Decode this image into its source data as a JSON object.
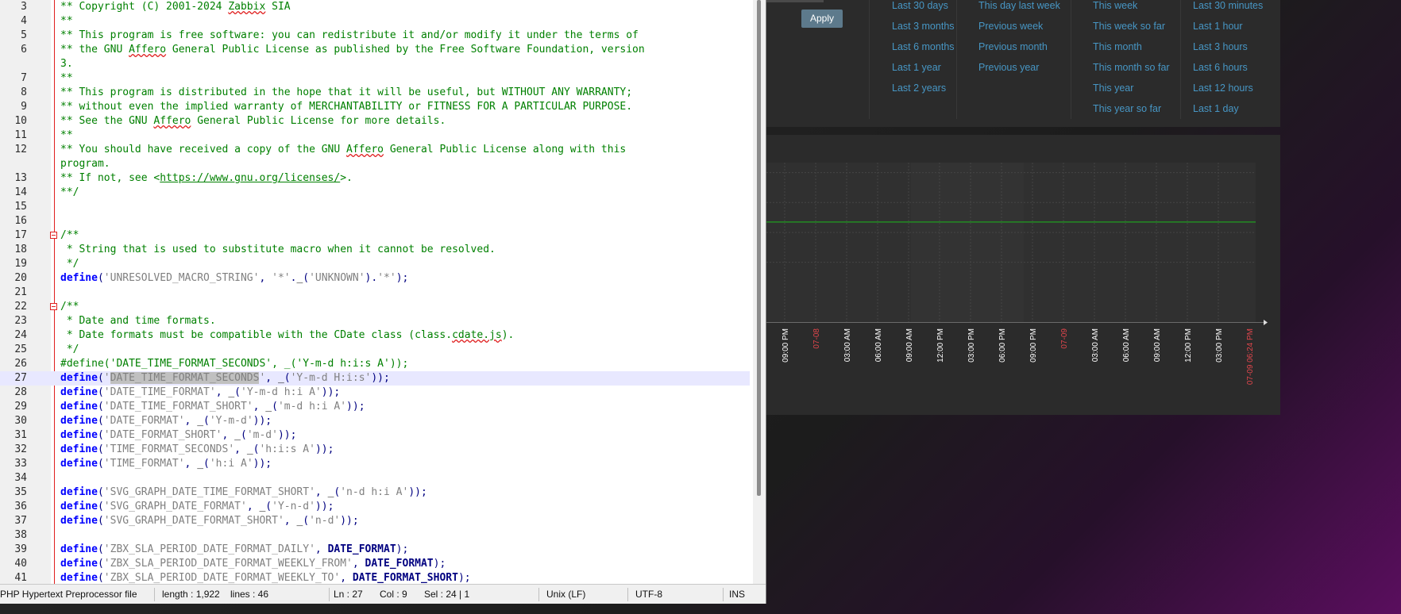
{
  "editor": {
    "lines": [
      {
        "n": "3",
        "fold": false,
        "t": [
          [
            "c",
            "** Copyright (C) 2001-2024 "
          ],
          [
            "cs",
            "Zabbix"
          ],
          [
            "c",
            " SIA"
          ]
        ]
      },
      {
        "n": "4",
        "fold": false,
        "t": [
          [
            "c",
            "**"
          ]
        ]
      },
      {
        "n": "5",
        "fold": false,
        "t": [
          [
            "c",
            "** This program is free software: you can redistribute it and/or modify it under the terms of"
          ]
        ]
      },
      {
        "n": "6",
        "fold": false,
        "t": [
          [
            "c",
            "** the GNU "
          ],
          [
            "cs",
            "Affero"
          ],
          [
            "c",
            " General Public License as published by the Free Software Foundation, version"
          ]
        ]
      },
      {
        "n": "",
        "fold": false,
        "t": [
          [
            "c",
            "3."
          ]
        ]
      },
      {
        "n": "7",
        "fold": false,
        "t": [
          [
            "c",
            "**"
          ]
        ]
      },
      {
        "n": "8",
        "fold": false,
        "t": [
          [
            "c",
            "** This program is distributed in the hope that it will be useful, but WITHOUT ANY WARRANTY;"
          ]
        ]
      },
      {
        "n": "9",
        "fold": false,
        "t": [
          [
            "c",
            "** without even the implied warranty of MERCHANTABILITY or FITNESS FOR A PARTICULAR PURPOSE."
          ]
        ]
      },
      {
        "n": "10",
        "fold": false,
        "t": [
          [
            "c",
            "** See the GNU "
          ],
          [
            "cs",
            "Affero"
          ],
          [
            "c",
            " General Public License for more details."
          ]
        ]
      },
      {
        "n": "11",
        "fold": false,
        "t": [
          [
            "c",
            "**"
          ]
        ]
      },
      {
        "n": "12",
        "fold": false,
        "t": [
          [
            "c",
            "** You should have received a copy of the GNU "
          ],
          [
            "cs",
            "Affero"
          ],
          [
            "c",
            " General Public License along with this"
          ]
        ]
      },
      {
        "n": "",
        "fold": false,
        "t": [
          [
            "c",
            "program."
          ]
        ]
      },
      {
        "n": "13",
        "fold": false,
        "t": [
          [
            "c",
            "** If not, see <"
          ],
          [
            "cu",
            "https://www.gnu.org/licenses/"
          ],
          [
            "c",
            ">."
          ]
        ]
      },
      {
        "n": "14",
        "fold": false,
        "t": [
          [
            "c",
            "**/"
          ]
        ]
      },
      {
        "n": "15",
        "fold": false,
        "t": []
      },
      {
        "n": "16",
        "fold": false,
        "t": []
      },
      {
        "n": "17",
        "fold": true,
        "t": [
          [
            "c",
            "/**"
          ]
        ]
      },
      {
        "n": "18",
        "fold": false,
        "t": [
          [
            "c",
            " * String that is used to substitute macro when it cannot be resolved."
          ]
        ]
      },
      {
        "n": "19",
        "fold": false,
        "t": [
          [
            "c",
            " */"
          ]
        ]
      },
      {
        "n": "20",
        "fold": false,
        "t": [
          [
            "k",
            "define"
          ],
          [
            "p",
            "("
          ],
          [
            "s",
            "'UNRESOLVED_MACRO_STRING'"
          ],
          [
            "p",
            ", "
          ],
          [
            "s",
            "'*'"
          ],
          [
            "p",
            "."
          ],
          [
            "d",
            "_"
          ],
          [
            "p",
            "("
          ],
          [
            "s",
            "'UNKNOWN'"
          ],
          [
            "p",
            ")."
          ],
          [
            "s",
            "'*'"
          ],
          [
            "p",
            ");"
          ]
        ]
      },
      {
        "n": "21",
        "fold": false,
        "t": []
      },
      {
        "n": "22",
        "fold": true,
        "t": [
          [
            "c",
            "/**"
          ]
        ]
      },
      {
        "n": "23",
        "fold": false,
        "t": [
          [
            "c",
            " * Date and time formats."
          ]
        ]
      },
      {
        "n": "24",
        "fold": false,
        "t": [
          [
            "c",
            " * Date formats must be compatible with the CDate class (class."
          ],
          [
            "cs",
            "cdate.js"
          ],
          [
            "c",
            ")."
          ]
        ]
      },
      {
        "n": "25",
        "fold": false,
        "t": [
          [
            "c",
            " */"
          ]
        ]
      },
      {
        "n": "26",
        "fold": false,
        "t": [
          [
            "c",
            "#define('DATE_TIME_FORMAT_SECONDS', _('Y-m-d h:i:s A'));"
          ]
        ]
      },
      {
        "n": "27",
        "fold": false,
        "current": true,
        "t": [
          [
            "k",
            "define"
          ],
          [
            "p",
            "("
          ],
          [
            "s",
            "'"
          ],
          [
            "sel",
            "DATE_TIME_FORMAT_SECONDS"
          ],
          [
            "s",
            "'"
          ],
          [
            "p",
            ", "
          ],
          [
            "d",
            "_"
          ],
          [
            "p",
            "("
          ],
          [
            "s",
            "'Y-m-d H:i:s'"
          ],
          [
            "p",
            "));"
          ]
        ]
      },
      {
        "n": "28",
        "fold": false,
        "t": [
          [
            "k",
            "define"
          ],
          [
            "p",
            "("
          ],
          [
            "s",
            "'DATE_TIME_FORMAT'"
          ],
          [
            "p",
            ", "
          ],
          [
            "d",
            "_"
          ],
          [
            "p",
            "("
          ],
          [
            "s",
            "'Y-m-d h:i A'"
          ],
          [
            "p",
            "));"
          ]
        ]
      },
      {
        "n": "29",
        "fold": false,
        "t": [
          [
            "k",
            "define"
          ],
          [
            "p",
            "("
          ],
          [
            "s",
            "'DATE_TIME_FORMAT_SHORT'"
          ],
          [
            "p",
            ", "
          ],
          [
            "d",
            "_"
          ],
          [
            "p",
            "("
          ],
          [
            "s",
            "'m-d h:i A'"
          ],
          [
            "p",
            "));"
          ]
        ]
      },
      {
        "n": "30",
        "fold": false,
        "t": [
          [
            "k",
            "define"
          ],
          [
            "p",
            "("
          ],
          [
            "s",
            "'DATE_FORMAT'"
          ],
          [
            "p",
            ", "
          ],
          [
            "d",
            "_"
          ],
          [
            "p",
            "("
          ],
          [
            "s",
            "'Y-m-d'"
          ],
          [
            "p",
            "));"
          ]
        ]
      },
      {
        "n": "31",
        "fold": false,
        "t": [
          [
            "k",
            "define"
          ],
          [
            "p",
            "("
          ],
          [
            "s",
            "'DATE_FORMAT_SHORT'"
          ],
          [
            "p",
            ", "
          ],
          [
            "d",
            "_"
          ],
          [
            "p",
            "("
          ],
          [
            "s",
            "'m-d'"
          ],
          [
            "p",
            "));"
          ]
        ]
      },
      {
        "n": "32",
        "fold": false,
        "t": [
          [
            "k",
            "define"
          ],
          [
            "p",
            "("
          ],
          [
            "s",
            "'TIME_FORMAT_SECONDS'"
          ],
          [
            "p",
            ", "
          ],
          [
            "d",
            "_"
          ],
          [
            "p",
            "("
          ],
          [
            "s",
            "'h:i:s A'"
          ],
          [
            "p",
            "));"
          ]
        ]
      },
      {
        "n": "33",
        "fold": false,
        "t": [
          [
            "k",
            "define"
          ],
          [
            "p",
            "("
          ],
          [
            "s",
            "'TIME_FORMAT'"
          ],
          [
            "p",
            ", "
          ],
          [
            "d",
            "_"
          ],
          [
            "p",
            "("
          ],
          [
            "s",
            "'h:i A'"
          ],
          [
            "p",
            "));"
          ]
        ]
      },
      {
        "n": "34",
        "fold": false,
        "t": []
      },
      {
        "n": "35",
        "fold": false,
        "t": [
          [
            "k",
            "define"
          ],
          [
            "p",
            "("
          ],
          [
            "s",
            "'SVG_GRAPH_DATE_TIME_FORMAT_SHORT'"
          ],
          [
            "p",
            ", "
          ],
          [
            "d",
            "_"
          ],
          [
            "p",
            "("
          ],
          [
            "s",
            "'n-d h:i A'"
          ],
          [
            "p",
            "));"
          ]
        ]
      },
      {
        "n": "36",
        "fold": false,
        "t": [
          [
            "k",
            "define"
          ],
          [
            "p",
            "("
          ],
          [
            "s",
            "'SVG_GRAPH_DATE_FORMAT'"
          ],
          [
            "p",
            ", "
          ],
          [
            "d",
            "_"
          ],
          [
            "p",
            "("
          ],
          [
            "s",
            "'Y-n-d'"
          ],
          [
            "p",
            "));"
          ]
        ]
      },
      {
        "n": "37",
        "fold": false,
        "t": [
          [
            "k",
            "define"
          ],
          [
            "p",
            "("
          ],
          [
            "s",
            "'SVG_GRAPH_DATE_FORMAT_SHORT'"
          ],
          [
            "p",
            ", "
          ],
          [
            "d",
            "_"
          ],
          [
            "p",
            "("
          ],
          [
            "s",
            "'n-d'"
          ],
          [
            "p",
            "));"
          ]
        ]
      },
      {
        "n": "38",
        "fold": false,
        "t": []
      },
      {
        "n": "39",
        "fold": false,
        "t": [
          [
            "k",
            "define"
          ],
          [
            "p",
            "("
          ],
          [
            "s",
            "'ZBX_SLA_PERIOD_DATE_FORMAT_DAILY'"
          ],
          [
            "p",
            ", "
          ],
          [
            "n",
            "DATE_FORMAT"
          ],
          [
            "p",
            ");"
          ]
        ]
      },
      {
        "n": "40",
        "fold": false,
        "t": [
          [
            "k",
            "define"
          ],
          [
            "p",
            "("
          ],
          [
            "s",
            "'ZBX_SLA_PERIOD_DATE_FORMAT_WEEKLY_FROM'"
          ],
          [
            "p",
            ", "
          ],
          [
            "n",
            "DATE_FORMAT"
          ],
          [
            "p",
            ");"
          ]
        ]
      },
      {
        "n": "41",
        "fold": false,
        "t": [
          [
            "k",
            "define"
          ],
          [
            "p",
            "("
          ],
          [
            "s",
            "'ZBX_SLA_PERIOD_DATE_FORMAT_WEEKLY_TO'"
          ],
          [
            "p",
            ", "
          ],
          [
            "n",
            "DATE_FORMAT_SHORT"
          ],
          [
            "p",
            ");"
          ]
        ]
      }
    ]
  },
  "status": {
    "file_type": "PHP Hypertext Preprocessor file",
    "length": "length : 1,922",
    "lines": "lines : 46",
    "ln": "Ln : 27",
    "col": "Col : 9",
    "sel": "Sel : 24 | 1",
    "eol": "Unix (LF)",
    "encoding": "UTF-8",
    "mode": "INS"
  },
  "dashboard": {
    "apply_label": "Apply",
    "quick_ranges": [
      [
        "Last 30 days",
        "Last 3 months",
        "Last 6 months",
        "Last 1 year",
        "Last 2 years"
      ],
      [
        "This day last week",
        "Previous week",
        "Previous month",
        "Previous year"
      ],
      [
        "This week",
        "This week so far",
        "This month",
        "This month so far",
        "This year",
        "This year so far"
      ],
      [
        "Last 30 minutes",
        "Last 1 hour",
        "Last 3 hours",
        "Last 6 hours",
        "Last 12 hours",
        "Last 1 day"
      ]
    ],
    "colors": {
      "link": "#4796c4",
      "series": "#1f9e1f",
      "date_tick": "#e0464c",
      "tick": "#ffffff"
    }
  },
  "chart_data": {
    "type": "line",
    "x_tick_labels": [
      "09:00 PM",
      "07-08",
      "03:00 AM",
      "06:00 AM",
      "09:00 AM",
      "12:00 PM",
      "03:00 PM",
      "06:00 PM",
      "09:00 PM",
      "07-09",
      "03:00 AM",
      "06:00 AM",
      "09:00 AM",
      "12:00 PM",
      "03:00 PM",
      "07-09 06:24 PM"
    ],
    "x_tick_is_date": [
      false,
      true,
      false,
      false,
      false,
      false,
      false,
      false,
      false,
      true,
      false,
      false,
      false,
      false,
      false,
      true
    ],
    "series": [
      {
        "values": [
          1,
          1
        ]
      }
    ],
    "ylim": [
      0,
      1.6
    ],
    "grid": true
  }
}
